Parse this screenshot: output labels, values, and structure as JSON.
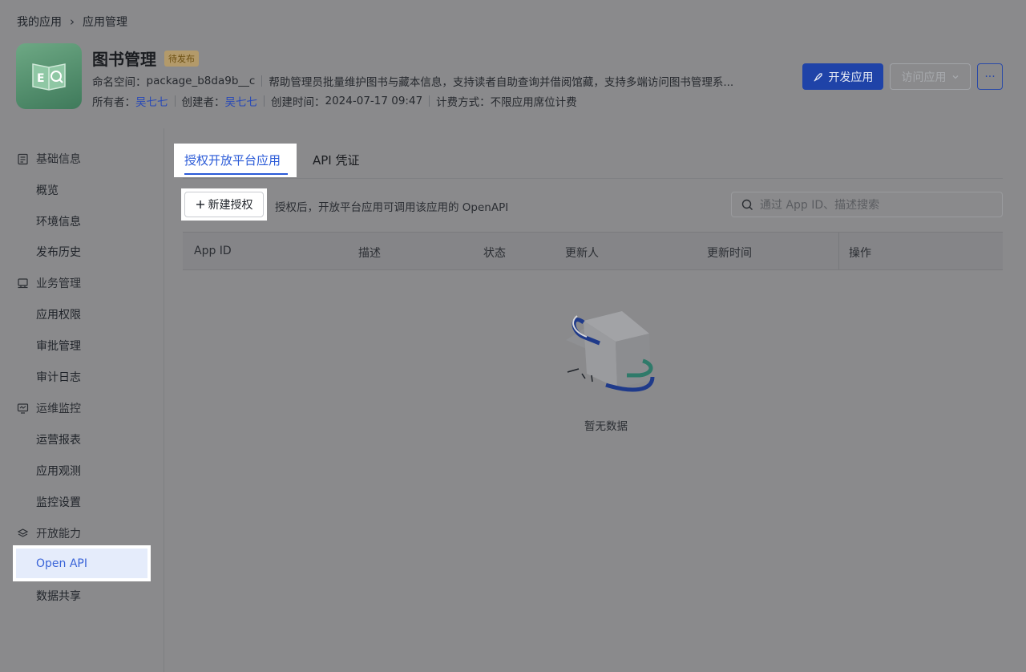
{
  "breadcrumb": {
    "parent": "我的应用",
    "current": "应用管理"
  },
  "app": {
    "name": "图书管理",
    "status_badge": "待发布",
    "namespace_label": "命名空间：",
    "namespace_value": "package_b8da9b__c",
    "description": "帮助管理员批量维护图书与藏本信息，支持读者自助查询并借阅馆藏，支持多端访问图书管理系...",
    "owner_label": "所有者：",
    "owner_value": "吴七七",
    "creator_label": "创建者：",
    "creator_value": "吴七七",
    "created_label": "创建时间：",
    "created_value": "2024-07-17 09:47",
    "billing_label": "计费方式：",
    "billing_value": "不限应用席位计费"
  },
  "header_actions": {
    "develop_label": "开发应用",
    "visit_label": "访问应用",
    "more_label": "···"
  },
  "sidebar": {
    "groups": [
      {
        "label": "基础信息",
        "icon": "document-icon",
        "items": [
          "概览",
          "环境信息",
          "发布历史"
        ]
      },
      {
        "label": "业务管理",
        "icon": "briefcase-icon",
        "items": [
          "应用权限",
          "审批管理",
          "审计日志"
        ]
      },
      {
        "label": "运维监控",
        "icon": "monitor-icon",
        "items": [
          "运营报表",
          "应用观测",
          "监控设置"
        ]
      },
      {
        "label": "开放能力",
        "icon": "layers-icon",
        "items": [
          "Open API",
          "数据共享"
        ]
      }
    ],
    "active_item": "Open API"
  },
  "tabs": [
    {
      "label": "授权开放平台应用",
      "active": true
    },
    {
      "label": "API 凭证",
      "active": false
    }
  ],
  "toolbar": {
    "new_button_label": "新建授权",
    "hint": "授权后，开放平台应用可调用该应用的 OpenAPI",
    "search_placeholder": "通过 App ID、描述搜索"
  },
  "table": {
    "columns": [
      "App ID",
      "描述",
      "状态",
      "更新人",
      "更新时间",
      "操作"
    ],
    "rows": [],
    "empty_text": "暂无数据"
  },
  "colors": {
    "accent": "#2a5ad7",
    "primary_button": "#1f43a8",
    "overlay_background": "#8a8a8c"
  }
}
